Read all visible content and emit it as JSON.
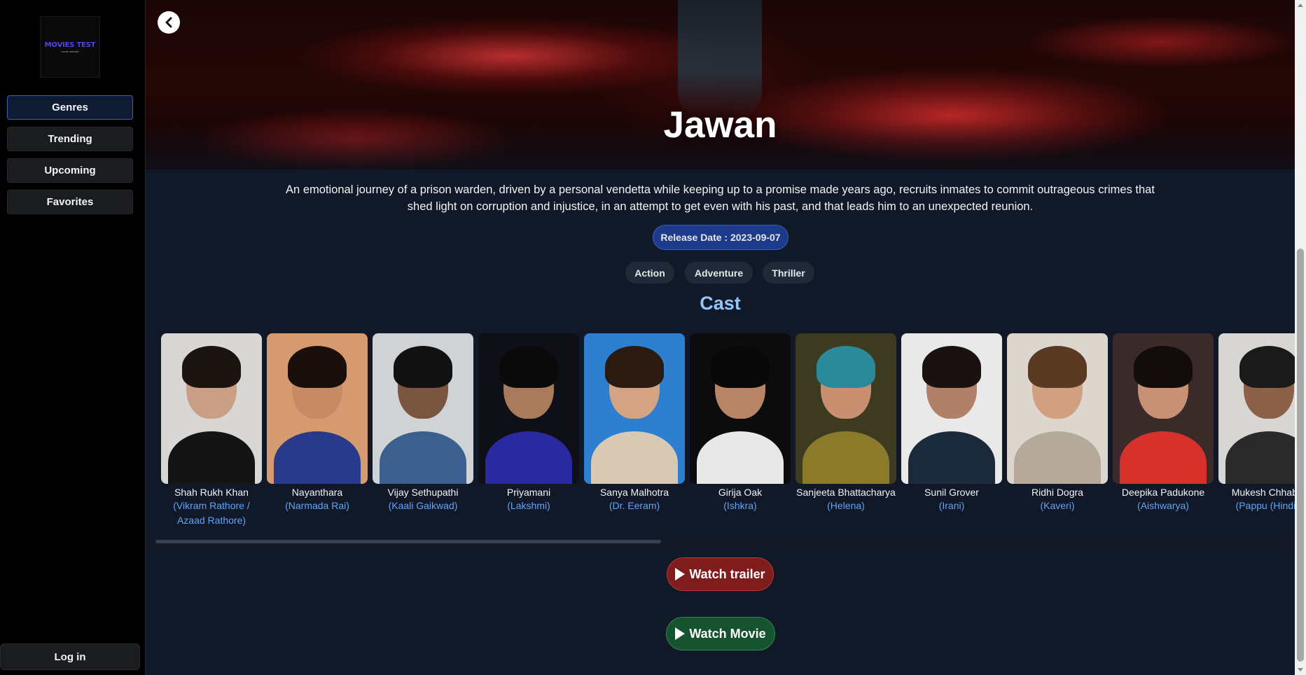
{
  "sidebar": {
    "logo_title": "MOVIES TEST",
    "logo_subtitle": "movie website",
    "nav": [
      {
        "label": "Genres",
        "active": true
      },
      {
        "label": "Trending"
      },
      {
        "label": "Upcoming"
      },
      {
        "label": "Favorites"
      }
    ],
    "login_label": "Log in"
  },
  "movie": {
    "title": "Jawan",
    "overview": "An emotional journey of a prison warden, driven by a personal vendetta while keeping up to a promise made years ago, recruits inmates to commit outrageous crimes that shed light on corruption and injustice, in an attempt to get even with his past, and that leads him to an unexpected reunion.",
    "release_date": "Release Date : 2023-09-07",
    "genres": [
      "Action",
      "Adventure",
      "Thriller"
    ]
  },
  "cast_heading": "Cast",
  "cast": [
    {
      "name": "Shah Rukh Khan",
      "role": "(Vikram Rathore / Azaad Rathore)"
    },
    {
      "name": "Nayanthara",
      "role": "(Narmada Rai)"
    },
    {
      "name": "Vijay Sethupathi",
      "role": "(Kaali Gaikwad)"
    },
    {
      "name": "Priyamani",
      "role": "(Lakshmi)"
    },
    {
      "name": "Sanya Malhotra",
      "role": "(Dr. Eeram)"
    },
    {
      "name": "Girija Oak",
      "role": "(Ishkra)"
    },
    {
      "name": "Sanjeeta Bhattacharya",
      "role": "(Helena)"
    },
    {
      "name": "Sunil Grover",
      "role": "(Irani)"
    },
    {
      "name": "Ridhi Dogra",
      "role": "(Kaveri)"
    },
    {
      "name": "Deepika Padukone",
      "role": "(Aishwarya)"
    },
    {
      "name": "Mukesh Chhabra",
      "role": "(Pappu (Hindi))"
    }
  ],
  "actions": {
    "trailer_label": "Watch trailer",
    "movie_label": "Watch Movie"
  }
}
